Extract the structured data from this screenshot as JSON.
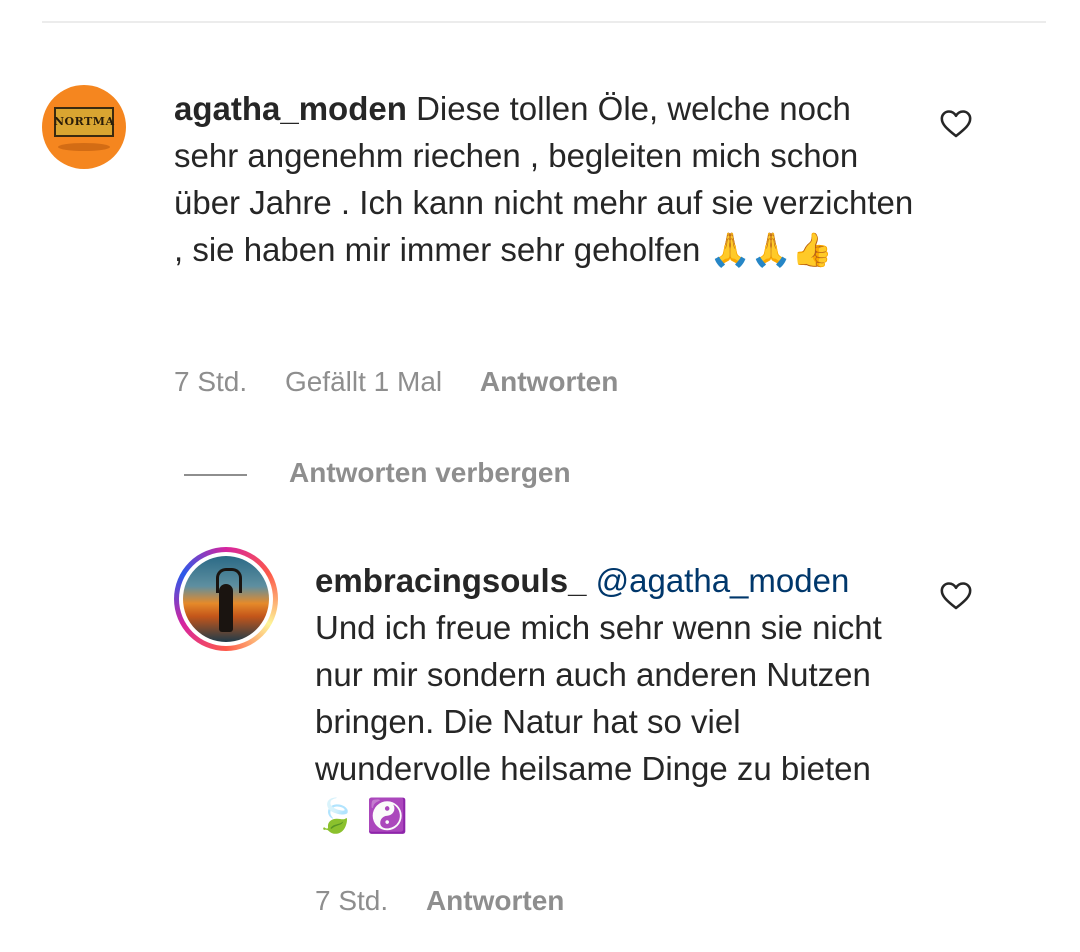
{
  "comments": [
    {
      "username": "agatha_moden",
      "avatar_text": "NORTMA",
      "text": "Diese tollen Öle, welche noch sehr angenehm riechen , begleiten mich schon über Jahre . Ich kann nicht mehr auf sie verzichten , sie haben mir immer sehr geholfen",
      "emojis": "🙏🙏👍",
      "time": "7 Std.",
      "likes": "Gefällt 1 Mal",
      "reply_label": "Antworten",
      "like_icon": "heart-outline-icon"
    },
    {
      "username": "embracingsouls_",
      "mention": "@agatha_moden",
      "text": "Und ich freue mich sehr wenn sie nicht nur mir sondern auch anderen Nutzen bringen. Die Natur hat so viel wundervolle heilsame Dinge zu bieten",
      "emojis": "🍃 ☯️",
      "time": "7 Std.",
      "reply_label": "Antworten",
      "like_icon": "heart-outline-icon"
    }
  ],
  "replies_toggle": "Antworten verbergen",
  "colors": {
    "text": "#262626",
    "muted": "#8e8e8e",
    "mention": "#00376b",
    "avatar_bg": "#f5861f"
  }
}
